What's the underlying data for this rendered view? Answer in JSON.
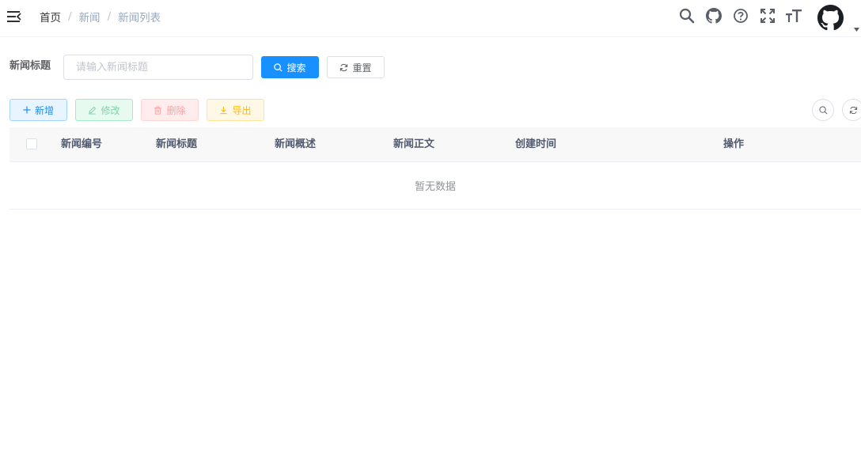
{
  "navbar": {
    "menu_icon": "hamburger-icon",
    "breadcrumb": [
      "首页",
      "新闻",
      "新闻列表"
    ],
    "breadcrumb_separator": "/",
    "icons": [
      "search-icon",
      "github-icon",
      "help-icon",
      "fullscreen-icon",
      "font-size-icon"
    ],
    "avatar_icon": "github-avatar",
    "caret_icon": "caret-down-icon"
  },
  "search_form": {
    "label": "新闻标题",
    "placeholder": "请输入新闻标题",
    "value": "",
    "search_label": "搜索",
    "reset_label": "重置"
  },
  "toolbar": {
    "add_label": "新增",
    "edit_label": "修改",
    "delete_label": "删除",
    "export_label": "导出",
    "right_icons": [
      "search-icon",
      "refresh-icon"
    ]
  },
  "table": {
    "columns": [
      "新闻编号",
      "新闻标题",
      "新闻概述",
      "新闻正文",
      "创建时间",
      "操作"
    ],
    "rows": [],
    "empty_text": "暂无数据"
  },
  "colors": {
    "primary": "#1890ff",
    "success": "#13ce66",
    "danger": "#ff4949",
    "warning": "#ffba00"
  }
}
